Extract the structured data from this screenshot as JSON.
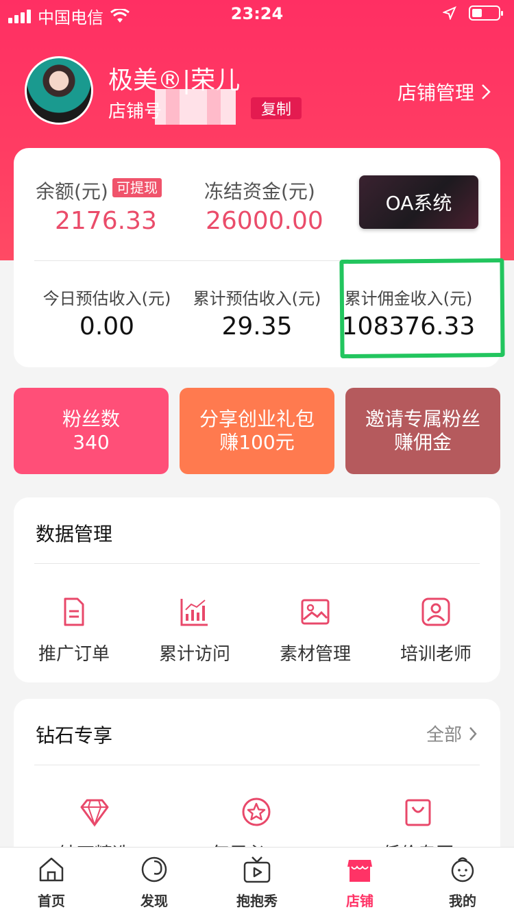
{
  "status_bar": {
    "carrier": "中国电信",
    "time": "23:24"
  },
  "profile": {
    "nickname": "极美®|荣儿",
    "shop_label": "店铺号",
    "copy_label": "复制",
    "manage_label": "店铺管理"
  },
  "balance": {
    "balance_label": "余额(元)",
    "withdraw_tag": "可提现",
    "balance_value": "2176.33",
    "frozen_label": "冻结资金(元)",
    "frozen_value": "26000.00",
    "oa_label": "OA系统"
  },
  "income": [
    {
      "label": "今日预估收入(元)",
      "value": "0.00"
    },
    {
      "label": "累计预估收入(元)",
      "value": "29.35"
    },
    {
      "label": "累计佣金收入(元)",
      "value": "108376.33"
    }
  ],
  "tiles": [
    {
      "line1": "粉丝数",
      "line2": "340",
      "color": "#ff4f78"
    },
    {
      "line1": "分享创业礼包",
      "line2": "赚100元",
      "color": "#ff7a4f"
    },
    {
      "line1": "邀请专属粉丝",
      "line2": "赚佣金",
      "color": "#b55a5d"
    }
  ],
  "data_management": {
    "title": "数据管理",
    "items": [
      {
        "label": "推广订单",
        "icon": "document-icon"
      },
      {
        "label": "累计访问",
        "icon": "bar-chart-icon"
      },
      {
        "label": "素材管理",
        "icon": "image-icon"
      },
      {
        "label": "培训老师",
        "icon": "user-portrait-icon"
      }
    ]
  },
  "diamond": {
    "title": "钻石专享",
    "more_label": "全部",
    "items": [
      {
        "label": "钻石精选",
        "icon": "diamond-icon"
      },
      {
        "label": "每周必BUY",
        "icon": "star-circle-icon"
      },
      {
        "label": "低价专区",
        "icon": "shopping-bag-icon"
      }
    ]
  },
  "tabbar": [
    {
      "label": "首页",
      "icon": "home-icon",
      "active": false
    },
    {
      "label": "发现",
      "icon": "discover-icon",
      "active": false
    },
    {
      "label": "抱抱秀",
      "icon": "tv-play-icon",
      "active": false
    },
    {
      "label": "店铺",
      "icon": "store-icon",
      "active": true
    },
    {
      "label": "我的",
      "icon": "baby-face-icon",
      "active": false
    }
  ],
  "colors": {
    "brand": "#ff3366",
    "accent_value": "#ea4c6a",
    "highlight": "#22c55e"
  }
}
